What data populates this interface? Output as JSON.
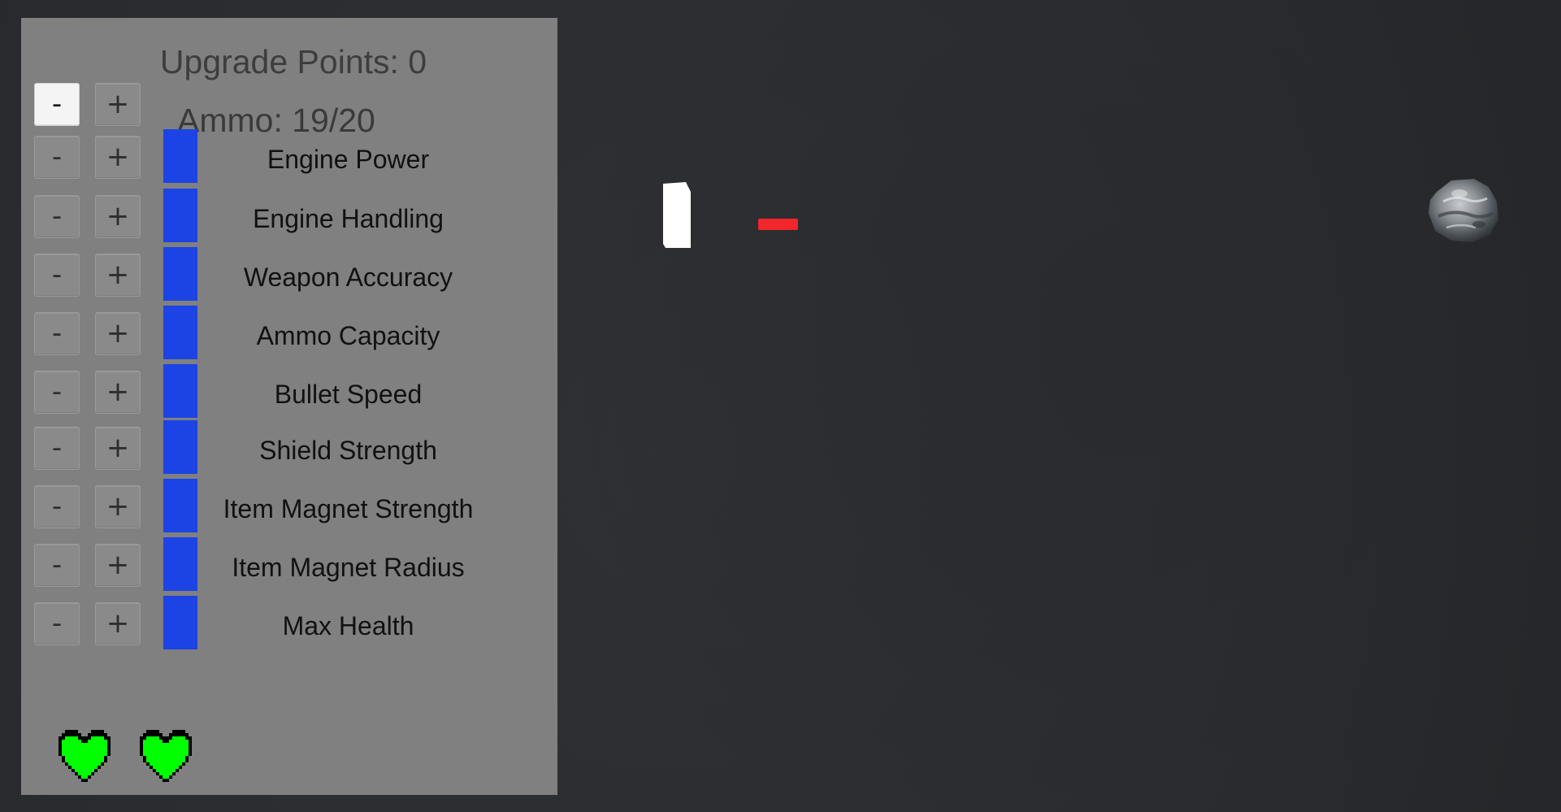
{
  "upgrade_panel": {
    "upgrade_points_text": "Upgrade Points: 0",
    "ammo": {
      "text": "Ammo: 19/20",
      "current": 19,
      "max": 20,
      "minus_label": "-",
      "plus_label": "+"
    },
    "stats": [
      {
        "label": "Engine Power",
        "minus_label": "-",
        "plus_label": "+",
        "level": 1
      },
      {
        "label": "Engine Handling",
        "minus_label": "-",
        "plus_label": "+",
        "level": 1
      },
      {
        "label": "Weapon Accuracy",
        "minus_label": "-",
        "plus_label": "+",
        "level": 1
      },
      {
        "label": "Ammo Capacity",
        "minus_label": "-",
        "plus_label": "+",
        "level": 1
      },
      {
        "label": "Bullet Speed",
        "minus_label": "-",
        "plus_label": "+",
        "level": 1
      },
      {
        "label": "Shield Strength",
        "minus_label": "-",
        "plus_label": "+",
        "level": 1
      },
      {
        "label": "Item Magnet Strength",
        "minus_label": "-",
        "plus_label": "+",
        "level": 1
      },
      {
        "label": "Item Magnet Radius",
        "minus_label": "-",
        "plus_label": "+",
        "level": 1
      },
      {
        "label": "Max Health",
        "minus_label": "-",
        "plus_label": "+",
        "level": 1
      }
    ],
    "hearts": {
      "count": 2,
      "color": "#00ff00",
      "icon": "heart-icon"
    }
  },
  "colors": {
    "background": "#2b2d30",
    "panel": "#808080",
    "stat_bar": "#1c44e4",
    "bullet": "#f2262b",
    "player": "#ffffff",
    "heart": "#00ff00"
  },
  "game_objects": {
    "player": "player-ship",
    "bullet": "bullet",
    "asteroid": "asteroid"
  }
}
